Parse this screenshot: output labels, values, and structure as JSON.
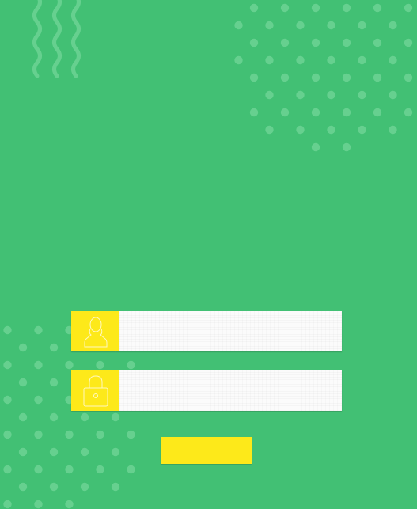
{
  "colors": {
    "background": "#42c074",
    "decor": "#66d08f",
    "accent_yellow": "#fde91a",
    "input_background": "#fbfbfb",
    "icon_stroke": "#fff8c0"
  },
  "login_form": {
    "username": {
      "icon": "user-icon",
      "placeholder": "",
      "value": ""
    },
    "password": {
      "icon": "lock-icon",
      "placeholder": "",
      "value": ""
    },
    "submit_label": ""
  },
  "decorations": {
    "top_left": "wavy-lines",
    "top_right": "dot-pattern",
    "bottom_left": "dot-pattern"
  }
}
